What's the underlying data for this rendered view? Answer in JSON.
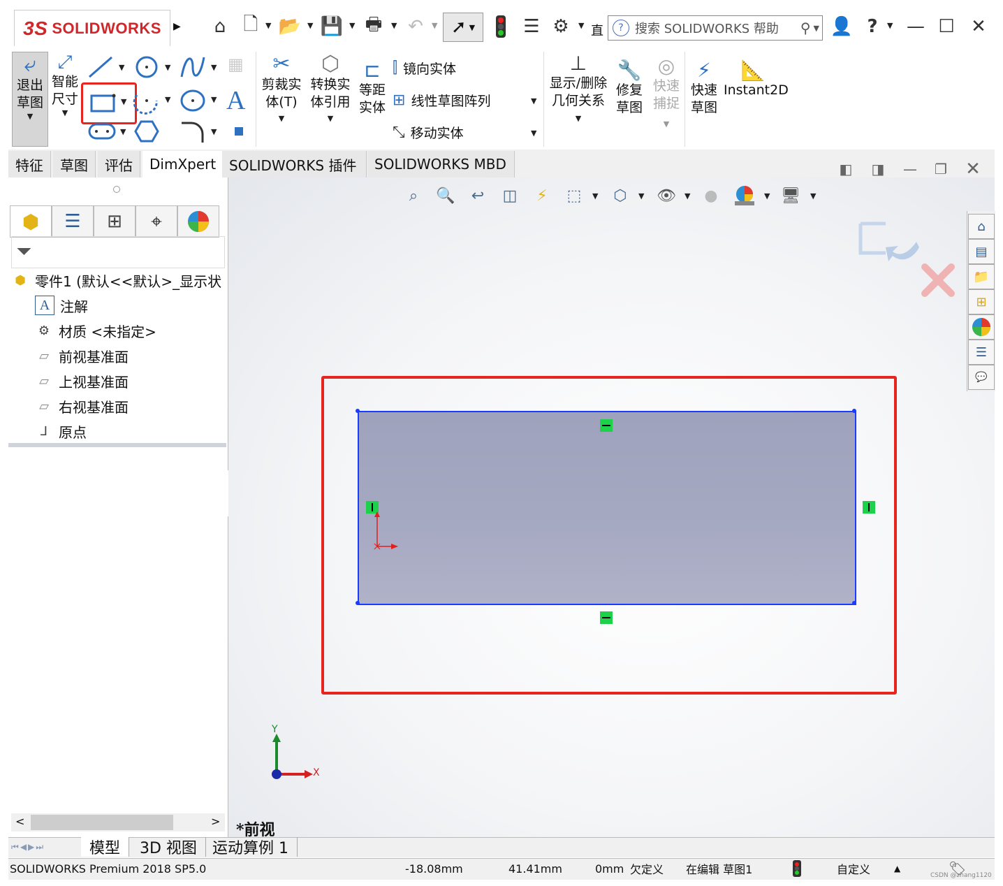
{
  "app": {
    "logo_ds": "3S",
    "logo_text": "SOLIDWORKS",
    "search_placeholder": "搜索 SOLIDWORKS 帮助",
    "title_cut": "直"
  },
  "ribbon": {
    "exit_sketch": "退出\n草图",
    "smart_dim": "智能\n尺寸",
    "trim": "剪裁实\n体(T)",
    "convert": "转换实\n体引用",
    "offset": "等距\n实体",
    "mirror": "镜向实体",
    "linear_pattern": "线性草图阵列",
    "move": "移动实体",
    "show_delete": "显示/删除\n几何关系",
    "repair": "修复\n草图",
    "quick_snap": "快速\n捕捉",
    "rapid_sketch": "快速\n草图",
    "instant2d": "Instant2D"
  },
  "tabs": [
    {
      "label": "特征"
    },
    {
      "label": "草图"
    },
    {
      "label": "评估"
    },
    {
      "label": "DimXpert"
    },
    {
      "label": "SOLIDWORKS 插件"
    },
    {
      "label": "SOLIDWORKS MBD"
    }
  ],
  "tree": {
    "root": "零件1 (默认<<默认>_显示状",
    "items": [
      {
        "label": "注解",
        "icon": "annotation-icon"
      },
      {
        "label": "材质 <未指定>",
        "icon": "material-icon"
      },
      {
        "label": "前视基准面",
        "icon": "plane-icon"
      },
      {
        "label": "上视基准面",
        "icon": "plane-icon"
      },
      {
        "label": "右视基准面",
        "icon": "plane-icon"
      },
      {
        "label": "原点",
        "icon": "origin-icon"
      }
    ]
  },
  "viewport": {
    "view_name": "*前视",
    "axis_x": "X",
    "axis_y": "Y"
  },
  "bottom_tabs": [
    {
      "label": "模型"
    },
    {
      "label": "3D 视图"
    },
    {
      "label": "运动算例 1"
    }
  ],
  "status": {
    "product": "SOLIDWORKS Premium 2018 SP5.0",
    "x": "-18.08mm",
    "y": "41.41mm",
    "z": "0mm",
    "define": "欠定义",
    "editing": "在编辑 草图1",
    "units": "自定义",
    "watermark": "CSDN @zhang1120"
  },
  "colors": {
    "highlight": "#e8241f",
    "sketch_line": "#1a3cff",
    "sketch_fill": "#a5a8c0",
    "relation": "#1ed14b"
  }
}
